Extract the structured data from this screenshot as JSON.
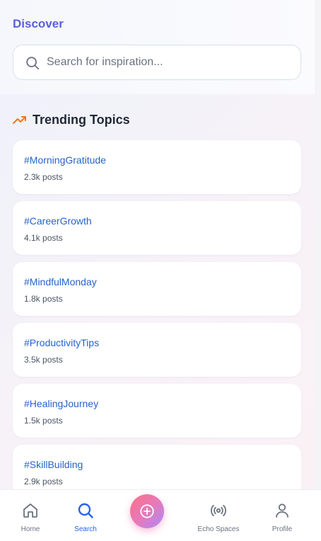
{
  "header": {
    "title": "Discover",
    "search_placeholder": "Search for inspiration..."
  },
  "trending": {
    "title": "Trending Topics",
    "icon": "trending-up-icon",
    "icon_color": "#f97316",
    "topics": [
      {
        "tag": "#MorningGratitude",
        "count": "2.3k posts"
      },
      {
        "tag": "#CareerGrowth",
        "count": "4.1k posts"
      },
      {
        "tag": "#MindfulMonday",
        "count": "1.8k posts"
      },
      {
        "tag": "#ProductivityTips",
        "count": "3.5k posts"
      },
      {
        "tag": "#HealingJourney",
        "count": "1.5k posts"
      },
      {
        "tag": "#SkillBuilding",
        "count": "2.9k posts"
      }
    ]
  },
  "nav": {
    "items": [
      {
        "label": "Home",
        "icon": "home-icon"
      },
      {
        "label": "Search",
        "icon": "search-icon",
        "active": true
      },
      {
        "label": "Echo Spaces",
        "icon": "broadcast-icon"
      },
      {
        "label": "Profile",
        "icon": "user-icon"
      }
    ],
    "create_icon": "plus-circle-icon"
  },
  "colors": {
    "accent": "#5b5fd6",
    "link": "#2563c9",
    "active_nav": "#2563eb",
    "fab_gradient": [
      "#fb7185",
      "#e879b9",
      "#a78bfa"
    ]
  }
}
